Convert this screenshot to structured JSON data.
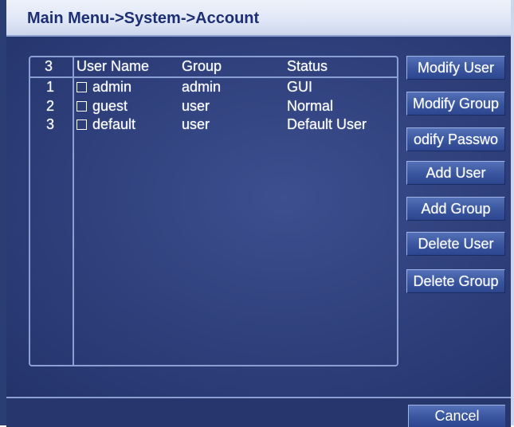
{
  "window": {
    "title": "Main Menu->System->Account"
  },
  "user_list": {
    "count": "3",
    "columns": {
      "user_name": "User Name",
      "group": "Group",
      "status": "Status"
    },
    "rows": [
      {
        "index": "1",
        "user_name": "admin",
        "group": "admin",
        "status": "GUI"
      },
      {
        "index": "2",
        "user_name": "guest",
        "group": "user",
        "status": "Normal"
      },
      {
        "index": "3",
        "user_name": "default",
        "group": "user",
        "status": "Default User"
      }
    ]
  },
  "actions": {
    "modify_user": "Modify User",
    "modify_group": "Modify Group",
    "modify_password": "odify Passwo",
    "add_user": "Add User",
    "add_group": "Add Group",
    "delete_user": "Delete User",
    "delete_group": "Delete Group"
  },
  "footer": {
    "cancel": "Cancel"
  },
  "colors": {
    "panel_background": "#2e3f7b",
    "title_text": "#1d2f73",
    "button_face": "#3b579f",
    "frame_line": "#8aa0d2"
  }
}
